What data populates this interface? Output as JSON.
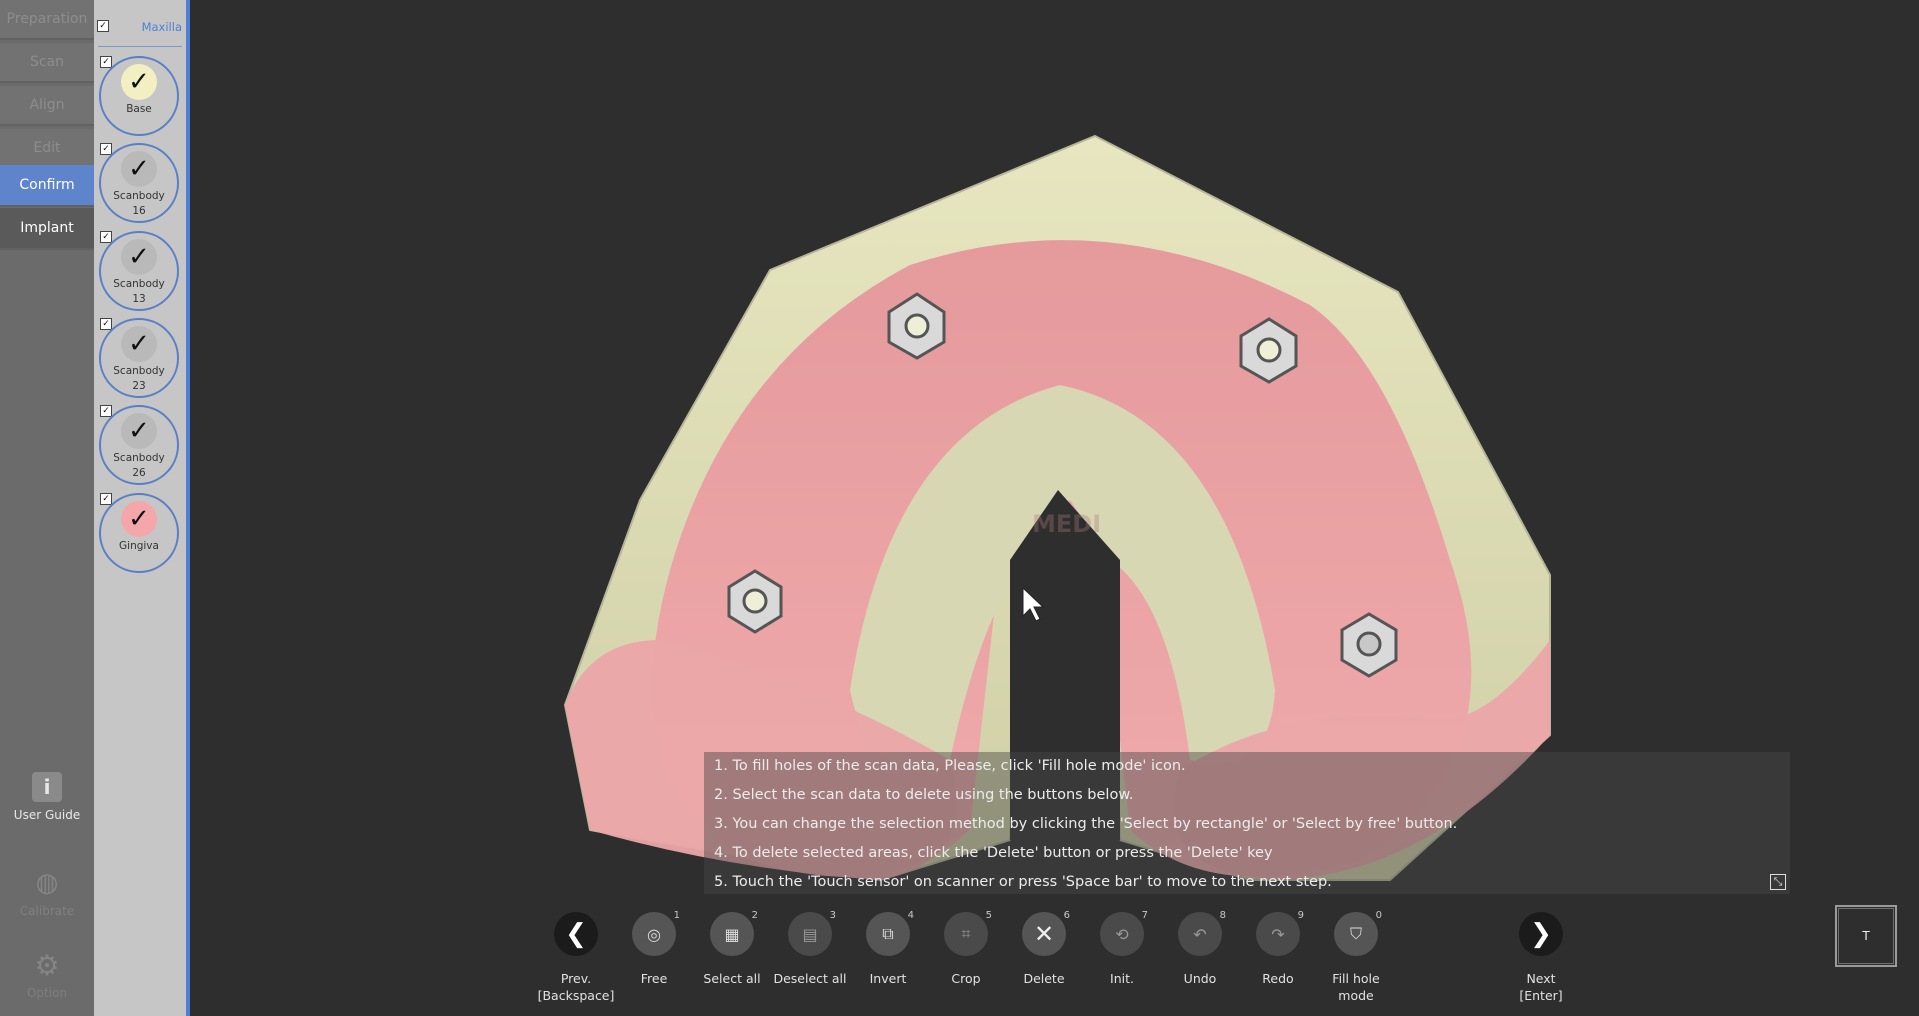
{
  "nav": {
    "items": [
      {
        "label": "Preparation",
        "state": "disabled"
      },
      {
        "label": "Scan",
        "state": "disabled"
      },
      {
        "label": "Align",
        "state": "disabled"
      },
      {
        "label": "Edit",
        "state": "disabled"
      },
      {
        "label": "Confirm",
        "state": "active"
      },
      {
        "label": "Implant",
        "state": "enabled"
      }
    ],
    "user_guide": "User Guide",
    "calibrate": "Calibrate",
    "option": "Option"
  },
  "layers": {
    "header": "Maxilla",
    "items": [
      {
        "label": "Base",
        "sub": "",
        "color": "#f2f0c2"
      },
      {
        "label": "Scanbody",
        "sub": "16",
        "color": "#b9b9b9"
      },
      {
        "label": "Scanbody",
        "sub": "13",
        "color": "#b9b9b9"
      },
      {
        "label": "Scanbody",
        "sub": "23",
        "color": "#b9b9b9"
      },
      {
        "label": "Scanbody",
        "sub": "26",
        "color": "#b9b9b9"
      },
      {
        "label": "Gingiva",
        "sub": "",
        "color": "#f4a7ab"
      }
    ]
  },
  "viewport": {
    "watermark": "MEDI"
  },
  "instructions": [
    "1. To fill holes of the scan data, Please, click 'Fill hole mode' icon.",
    "2. Select the scan data to delete using the buttons below.",
    "3. You can change the selection method by clicking the 'Select by rectangle' or 'Select by free' button.",
    "4. To delete selected areas, click the 'Delete' button or press the 'Delete' key",
    "5. Touch the 'Touch sensor' on scanner or press 'Space bar' to move to the next step."
  ],
  "toolbar": {
    "prev": {
      "label": "Prev.",
      "sub": "[Backspace]"
    },
    "next": {
      "label": "Next",
      "sub": "[Enter]"
    },
    "tools": [
      {
        "label": "Free",
        "key": "1",
        "icon": "lasso-icon",
        "enabled": true
      },
      {
        "label": "Select all",
        "key": "2",
        "icon": "select-all-icon",
        "enabled": true
      },
      {
        "label": "Deselect all",
        "key": "3",
        "icon": "deselect-all-icon",
        "enabled": true
      },
      {
        "label": "Invert",
        "key": "4",
        "icon": "invert-icon",
        "enabled": true
      },
      {
        "label": "Crop",
        "key": "5",
        "icon": "crop-icon",
        "enabled": true
      },
      {
        "label": "Delete",
        "key": "6",
        "icon": "delete-x-icon",
        "enabled": true
      },
      {
        "label": "Init.",
        "key": "7",
        "icon": "init-icon",
        "enabled": true
      },
      {
        "label": "Undo",
        "key": "8",
        "icon": "undo-icon",
        "enabled": true
      },
      {
        "label": "Redo",
        "key": "9",
        "icon": "redo-icon",
        "enabled": true
      },
      {
        "label": "Fill hole mode",
        "key": "0",
        "icon": "fill-hole-icon",
        "enabled": true
      }
    ],
    "sensor_label": "T"
  }
}
